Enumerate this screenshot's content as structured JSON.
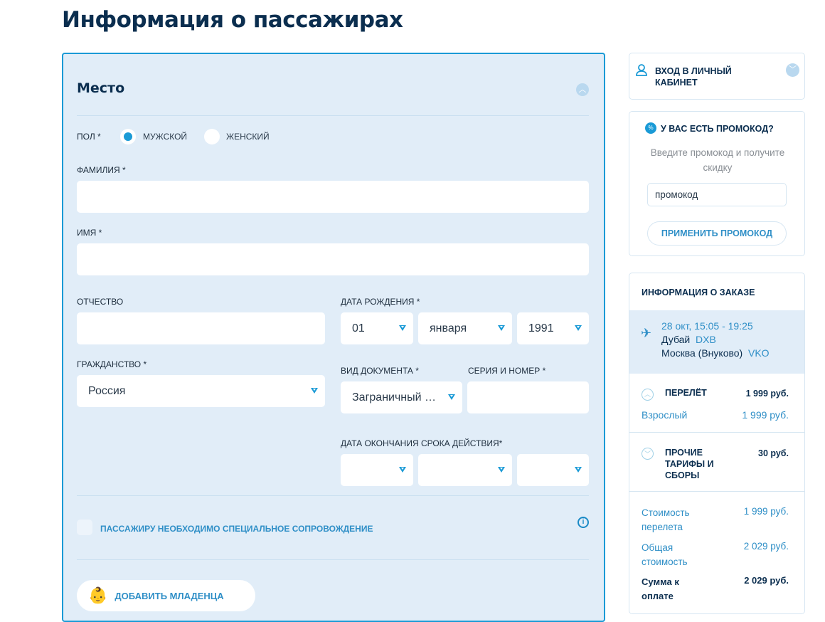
{
  "page_title": "Информация о пассажирах",
  "form": {
    "section_title": "Место",
    "gender_label": "ПОЛ *",
    "gender_male": "МУЖСКОЙ",
    "gender_female": "ЖЕНСКИЙ",
    "gender_selected": "male",
    "lastname_label": "ФАМИЛИЯ *",
    "lastname_value": "",
    "firstname_label": "ИМЯ *",
    "firstname_value": "",
    "patronymic_label": "ОТЧЕСТВО",
    "patronymic_value": "",
    "birthdate_label": "ДАТА РОЖДЕНИЯ *",
    "birth_day": "01",
    "birth_month": "января",
    "birth_year": "1991",
    "citizenship_label": "ГРАЖДАНСТВО *",
    "citizenship_value": "Россия",
    "doctype_label": "ВИД ДОКУМЕНТА *",
    "doctype_value": "Заграничный …",
    "docnumber_label": "СЕРИЯ И НОМЕР *",
    "docnumber_value": "",
    "expiry_label": "ДАТА ОКОНЧАНИЯ СРОКА ДЕЙСТВИЯ*",
    "special_label": "ПАССАЖИРУ НЕОБХОДИМО СПЕЦИАЛЬНОЕ СОПРОВОЖДЕНИЕ",
    "add_infant": "ДОБАВИТЬ МЛАДЕНЦА"
  },
  "login": {
    "title": "ВХОД В ЛИЧНЫЙ КАБИНЕТ"
  },
  "promo": {
    "title": "У ВАС ЕСТЬ ПРОМОКОД?",
    "desc": "Введите промокод и получите скидку",
    "placeholder": "промокод",
    "apply": "ПРИМЕНИТЬ ПРОМОКОД"
  },
  "order": {
    "title": "ИНФОРМАЦИЯ О ЗАКАЗЕ",
    "flight_time": "28 окт, 15:05 - 19:25",
    "from_city": "Дубай",
    "from_code": "DXB",
    "to_city": "Москва (Внуково)",
    "to_code": "VKO",
    "flight_label": "ПЕРЕЛЁТ",
    "flight_price": "1 999 руб.",
    "adult_label": "Взрослый",
    "adult_price": "1 999 руб.",
    "fees_label": "ПРОЧИЕ ТАРИФЫ И СБОРЫ",
    "fees_price": "30 руб.",
    "cost_label": "Стоимость перелета",
    "cost_price": "1 999 руб.",
    "total_label": "Общая стоимость",
    "total_price": "2 029 руб.",
    "pay_label": "Сумма к оплате",
    "pay_price": "2 029 руб."
  }
}
